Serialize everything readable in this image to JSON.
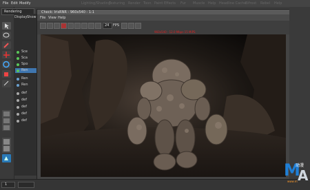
{
  "main_menu": [
    "File",
    "Edit",
    "Modify",
    "Create",
    "Display",
    "Window",
    "Lighting/Shading",
    "Texturing",
    "Render",
    "Toon",
    "Paint Effects",
    "Fur",
    "Muscle",
    "Help",
    "Headline Cache",
    "Bifrost",
    "Rebel",
    "Help"
  ],
  "menu_set": "Rendering",
  "window": {
    "title": "Check: IrisRNR - 960x540 - 1:1",
    "menus": [
      "File",
      "View",
      "Help"
    ],
    "fps_value": "24",
    "fps_label": "FPS",
    "status_text": "960x540 - 12.0 Mbps 15 MiPS"
  },
  "outliner": {
    "header": [
      "Display",
      "Show"
    ],
    "items": [
      {
        "label": "Sce",
        "color": "#5ac85a"
      },
      {
        "label": "Sca",
        "color": "#5ac85a"
      },
      {
        "label": "Spo",
        "color": "#5ac85a"
      },
      {
        "label": "Ren",
        "color": "#5ac85a",
        "selected": true
      },
      {
        "label": "Ren",
        "color": "#6aa0d0"
      },
      {
        "label": "Ren",
        "color": "#6aa0d0"
      },
      {
        "label": "def",
        "color": "#aaaaaa"
      },
      {
        "label": "def",
        "color": "#aaaaaa"
      },
      {
        "label": "def",
        "color": "#aaaaaa"
      },
      {
        "label": "def",
        "color": "#aaaaaa"
      },
      {
        "label": "def",
        "color": "#aaaaaa"
      }
    ]
  },
  "timeline": {
    "start": "1"
  },
  "colors": {
    "accent": "#1f7fd6",
    "status_red": "#dd2222"
  },
  "watermark": {
    "brand_cn": "动漫",
    "letters_m": "M",
    "letters_a": "A",
    "url": "www.m"
  }
}
